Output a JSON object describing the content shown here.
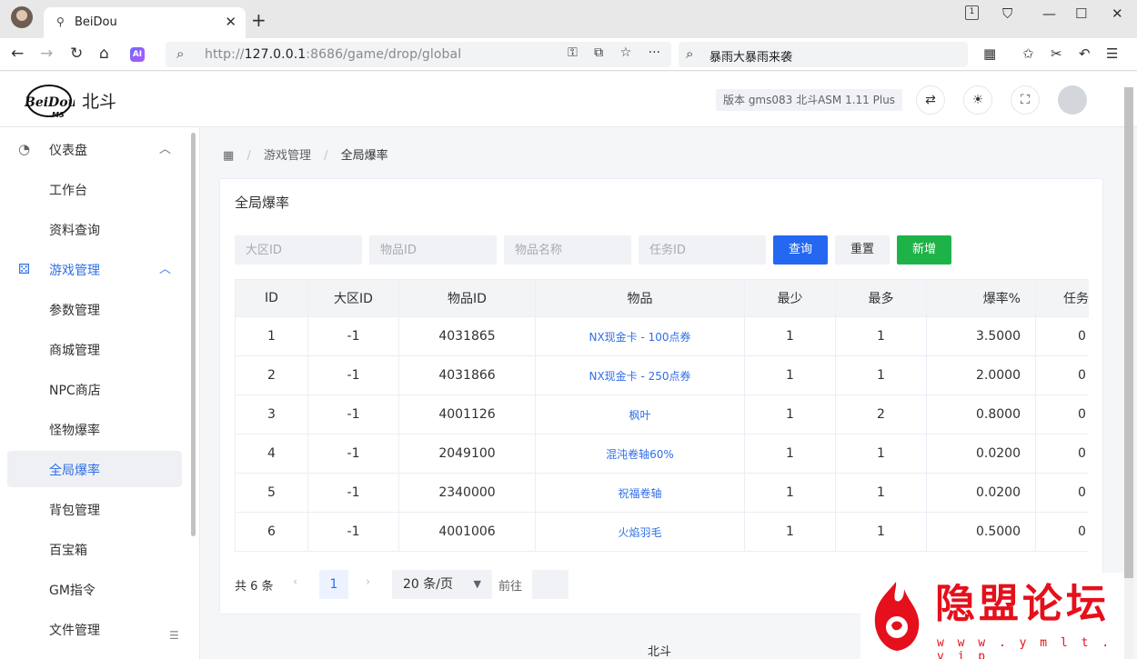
{
  "browser": {
    "tab_title": "BeiDou",
    "tab_count": "1",
    "url_scheme": "http://",
    "url_host": "127.0.0.1",
    "url_rest": ":8686/game/drop/global",
    "search_text": "暴雨大暴雨来袭"
  },
  "header": {
    "logo_text": "北斗",
    "version": "版本 gms083 北斗ASM 1.11 Plus"
  },
  "sidebar": {
    "items": [
      {
        "label": "仪表盘"
      },
      {
        "label": "工作台"
      },
      {
        "label": "资料查询"
      },
      {
        "label": "游戏管理"
      },
      {
        "label": "参数管理"
      },
      {
        "label": "商城管理"
      },
      {
        "label": "NPC商店"
      },
      {
        "label": "怪物爆率"
      },
      {
        "label": "全局爆率"
      },
      {
        "label": "背包管理"
      },
      {
        "label": "百宝箱"
      },
      {
        "label": "GM指令"
      },
      {
        "label": "文件管理"
      }
    ]
  },
  "breadcrumb": {
    "parent": "游戏管理",
    "current": "全局爆率",
    "separator": "/"
  },
  "card": {
    "title": "全局爆率"
  },
  "filters": {
    "zone_placeholder": "大区ID",
    "item_id_placeholder": "物品ID",
    "item_name_placeholder": "物品名称",
    "quest_id_placeholder": "任务ID",
    "query_label": "查询",
    "reset_label": "重置",
    "add_label": "新增"
  },
  "table": {
    "headers": [
      "ID",
      "大区ID",
      "物品ID",
      "物品",
      "最少",
      "最多",
      "爆率%",
      "任务ID"
    ],
    "rows": [
      [
        "1",
        "-1",
        "4031865",
        "NX现金卡 - 100点券",
        "1",
        "1",
        "3.5000",
        "0"
      ],
      [
        "2",
        "-1",
        "4031866",
        "NX现金卡 - 250点券",
        "1",
        "1",
        "2.0000",
        "0"
      ],
      [
        "3",
        "-1",
        "4001126",
        "枫叶",
        "1",
        "2",
        "0.8000",
        "0"
      ],
      [
        "4",
        "-1",
        "2049100",
        "混沌卷轴60%",
        "1",
        "1",
        "0.0200",
        "0"
      ],
      [
        "5",
        "-1",
        "2340000",
        "祝福卷轴",
        "1",
        "1",
        "0.0200",
        "0"
      ],
      [
        "6",
        "-1",
        "4001006",
        "火焰羽毛",
        "1",
        "1",
        "0.5000",
        "0"
      ]
    ]
  },
  "pagination": {
    "total": "共 6 条",
    "current_page": "1",
    "page_size": "20 条/页",
    "goto_label": "前往"
  },
  "footer": {
    "text": "北斗"
  },
  "watermark": {
    "title": "隐盟论坛",
    "url": "w w w . y m l t . v i p"
  },
  "colors": {
    "primary": "#2468f2",
    "success": "#1eb349",
    "link": "#2f6ee8",
    "watermark": "#e5101b"
  }
}
